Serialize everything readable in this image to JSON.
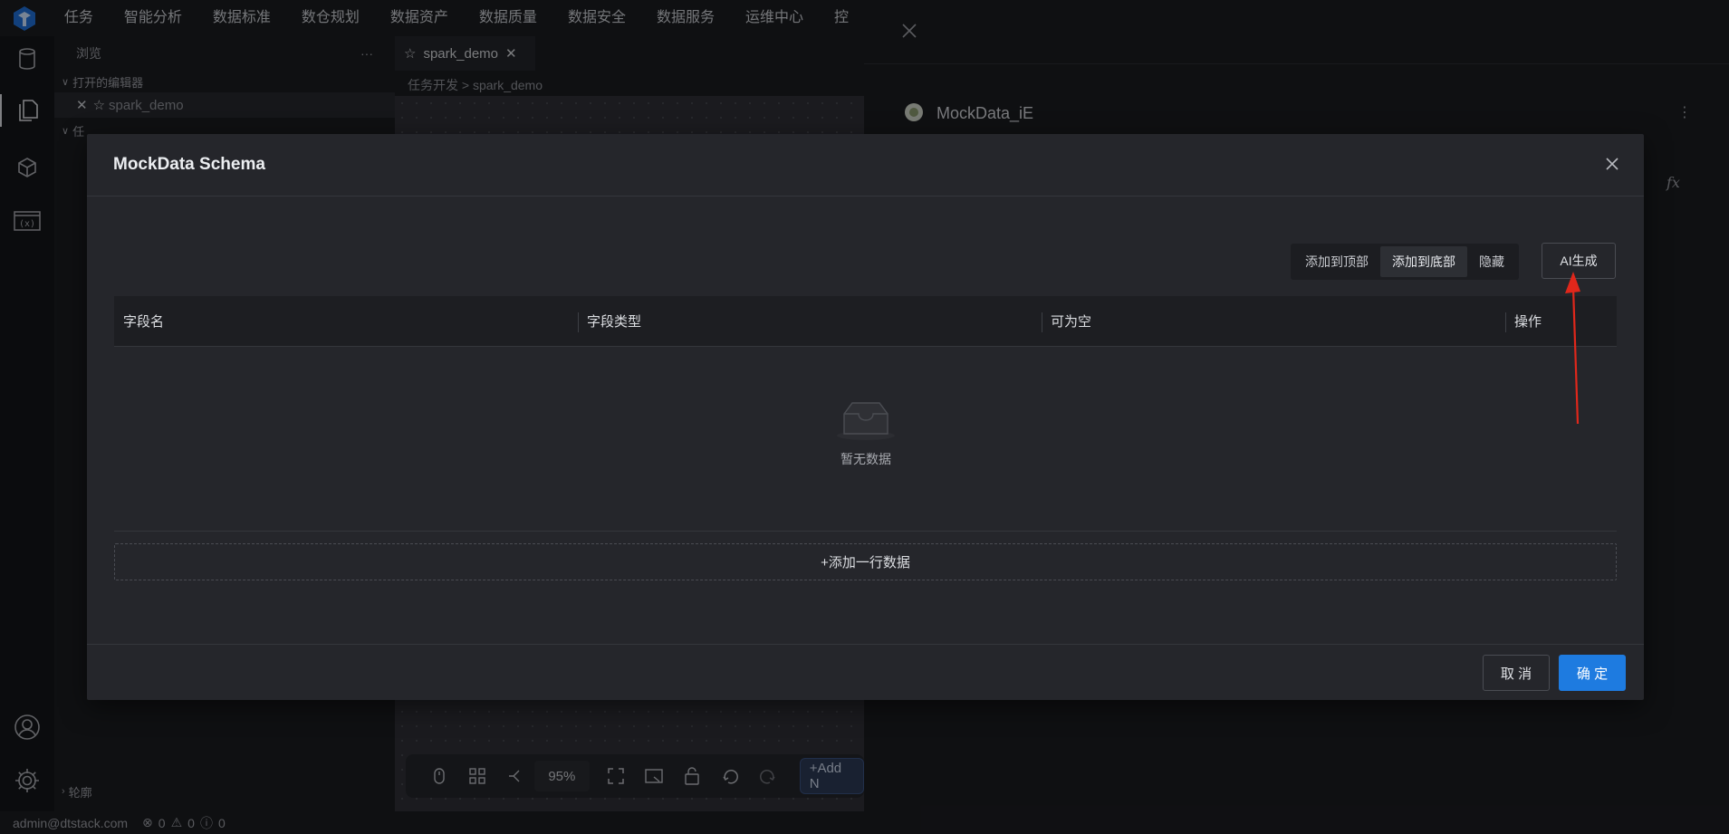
{
  "top_menu": [
    "任务",
    "智能分析",
    "数据标准",
    "数仓规划",
    "数据资产",
    "数据质量",
    "数据安全",
    "数据服务",
    "运维中心",
    "控"
  ],
  "explorer": {
    "title": "浏览",
    "more": "···",
    "open_editors": "打开的编辑器",
    "open_file": "spark_demo",
    "task_section": "任",
    "outline": "轮廓"
  },
  "editor": {
    "tab_label": "spark_demo",
    "breadcrumb_root": "任务开发",
    "breadcrumb_sep": ">",
    "breadcrumb_leaf": "spark_demo"
  },
  "right_panel": {
    "node_name": "MockData_iE",
    "fx": "fx"
  },
  "canvas_toolbar": {
    "zoom": "95%",
    "add_node": "+Add N"
  },
  "status_bar": {
    "user": "admin@dtstack.com",
    "errors": "0",
    "warnings": "0",
    "infos": "0"
  },
  "modal": {
    "title": "MockData Schema",
    "buttons": {
      "add_top": "添加到顶部",
      "add_bottom": "添加到底部",
      "hide": "隐藏",
      "ai_generate": "AI生成"
    },
    "columns": [
      "字段名",
      "字段类型",
      "可为空",
      "操作"
    ],
    "empty_text": "暂无数据",
    "add_row": "+添加一行数据",
    "cancel": "取 消",
    "ok": "确 定"
  },
  "colors": {
    "primary": "#1e7be0",
    "annotation_arrow": "#e0271b"
  }
}
